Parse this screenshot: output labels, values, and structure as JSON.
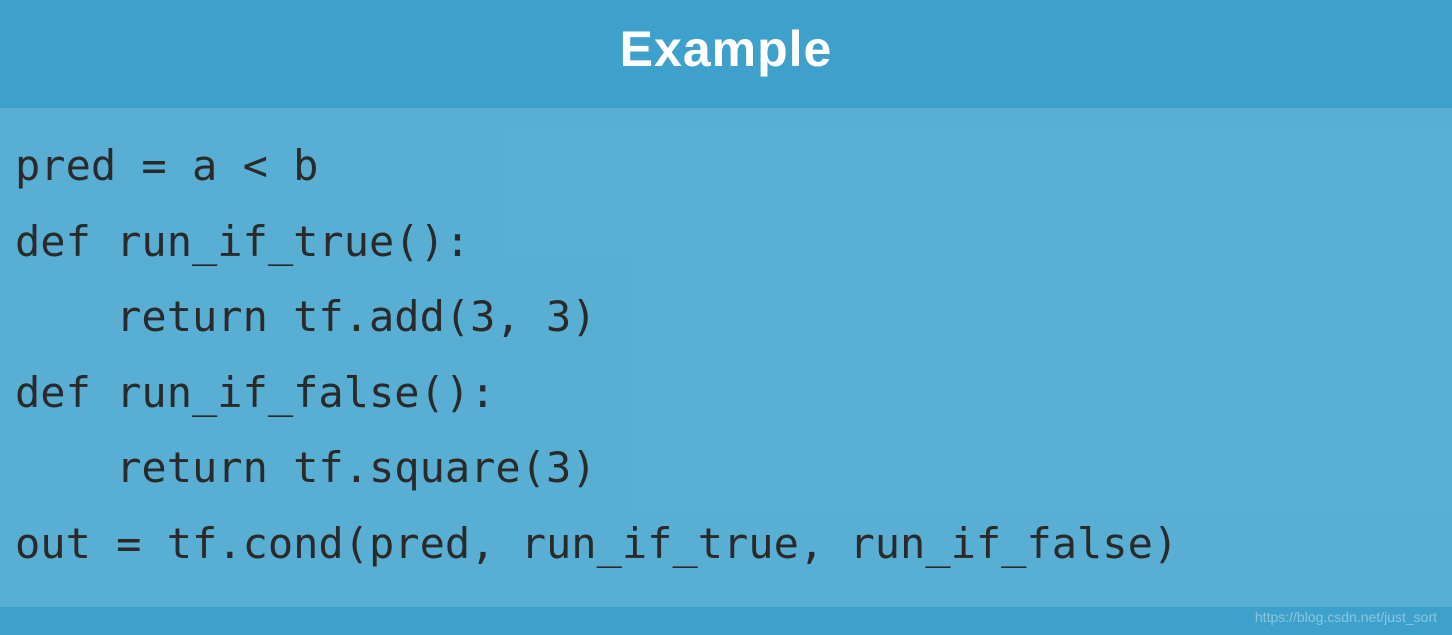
{
  "header": {
    "title": "Example"
  },
  "code": {
    "line1": "pred = a < b",
    "line2": "def run_if_true():",
    "line3": "    return tf.add(3, 3)",
    "line4": "def run_if_false():",
    "line5": "    return tf.square(3)",
    "line6": "out = tf.cond(pred, run_if_true, run_if_false)"
  },
  "watermark": {
    "text": "https://blog.csdn.net/just_sort"
  }
}
